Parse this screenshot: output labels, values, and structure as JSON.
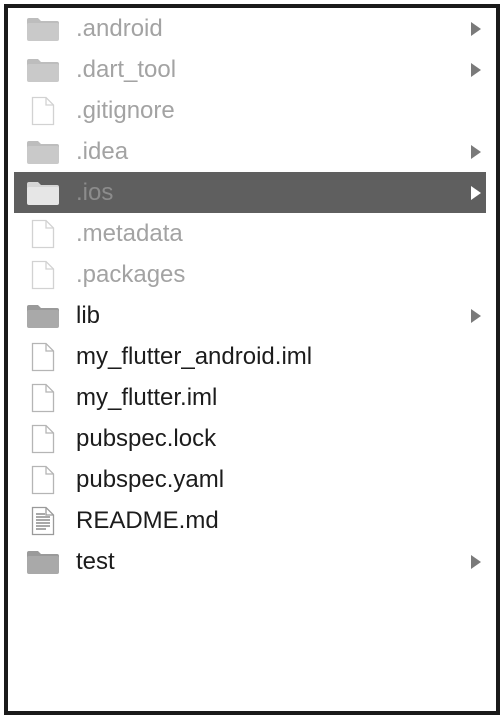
{
  "colors": {
    "selection_background": "#5f5f5f",
    "text_normal": "#1c1c1c",
    "text_hidden": "#a3a3a3",
    "folder_fill": "#a9a9a9",
    "chevron": "#7a7a7a"
  },
  "items": [
    {
      "label": ".android",
      "kind": "folder",
      "hidden": true,
      "expandable": true,
      "selected": false,
      "icon": "folder-icon"
    },
    {
      "label": ".dart_tool",
      "kind": "folder",
      "hidden": true,
      "expandable": true,
      "selected": false,
      "icon": "folder-icon"
    },
    {
      "label": ".gitignore",
      "kind": "file",
      "hidden": true,
      "expandable": false,
      "selected": false,
      "icon": "file-icon"
    },
    {
      "label": ".idea",
      "kind": "folder",
      "hidden": true,
      "expandable": true,
      "selected": false,
      "icon": "folder-icon"
    },
    {
      "label": ".ios",
      "kind": "folder",
      "hidden": true,
      "expandable": true,
      "selected": true,
      "icon": "folder-icon"
    },
    {
      "label": ".metadata",
      "kind": "file",
      "hidden": true,
      "expandable": false,
      "selected": false,
      "icon": "file-icon"
    },
    {
      "label": ".packages",
      "kind": "file",
      "hidden": true,
      "expandable": false,
      "selected": false,
      "icon": "file-icon"
    },
    {
      "label": "lib",
      "kind": "folder",
      "hidden": false,
      "expandable": true,
      "selected": false,
      "icon": "folder-icon"
    },
    {
      "label": "my_flutter_android.iml",
      "kind": "file",
      "hidden": false,
      "expandable": false,
      "selected": false,
      "icon": "file-icon"
    },
    {
      "label": "my_flutter.iml",
      "kind": "file",
      "hidden": false,
      "expandable": false,
      "selected": false,
      "icon": "file-icon"
    },
    {
      "label": "pubspec.lock",
      "kind": "file",
      "hidden": false,
      "expandable": false,
      "selected": false,
      "icon": "file-icon"
    },
    {
      "label": "pubspec.yaml",
      "kind": "file",
      "hidden": false,
      "expandable": false,
      "selected": false,
      "icon": "file-icon"
    },
    {
      "label": "README.md",
      "kind": "text",
      "hidden": false,
      "expandable": false,
      "selected": false,
      "icon": "text-document-icon"
    },
    {
      "label": "test",
      "kind": "folder",
      "hidden": false,
      "expandable": true,
      "selected": false,
      "icon": "folder-icon"
    }
  ]
}
